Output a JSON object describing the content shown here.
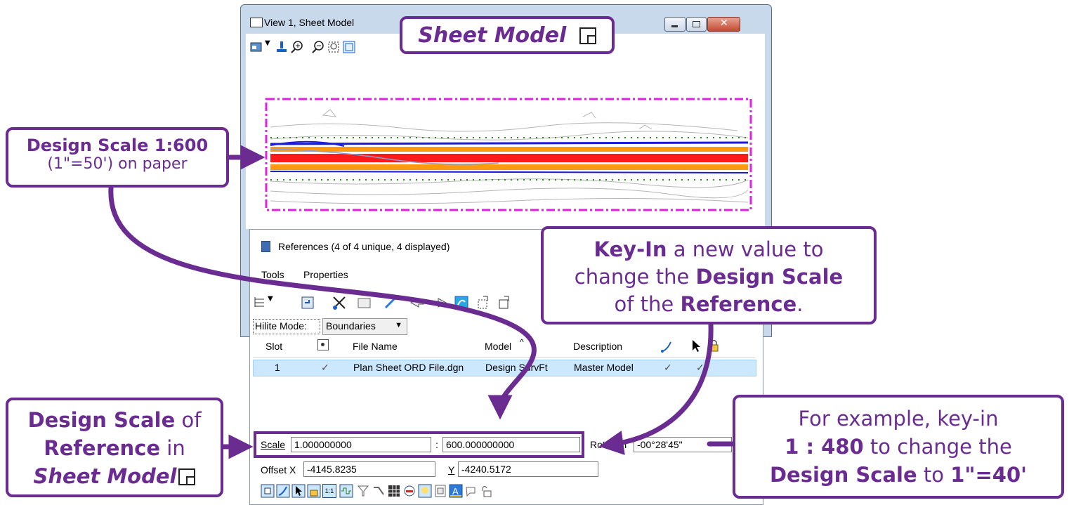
{
  "window": {
    "title": "View 1, Sheet Model"
  },
  "references": {
    "title": "References (4 of 4 unique, 4 displayed)",
    "menu": [
      "Tools",
      "Properties"
    ],
    "hilite_label": "Hilite Mode:",
    "hilite_value": "Boundaries",
    "columns": [
      "Slot",
      "File Name",
      "Model",
      "Description"
    ],
    "rows": [
      {
        "slot": "1",
        "display_check": "✓",
        "file_name": "Plan Sheet ORD File.dgn",
        "model": "Design SurvFt",
        "description": "Master Model",
        "check1": "✓",
        "check2": "✓"
      }
    ],
    "scale_label": "Scale",
    "scale_master": "1.000000000",
    "scale_sep": ":",
    "scale_ref": "600.000000000",
    "rotation_label": "Rotation",
    "rotation_value": "-00°28'45\"",
    "offset_x_label": "Offset X",
    "offset_x": "-4145.8235",
    "offset_y_label": "Y",
    "offset_y": "-4240.5172",
    "scale_btn": "1:1"
  },
  "callouts": {
    "sheet_model": "Sheet Model",
    "design_scale_title": "Design Scale 1:600",
    "design_scale_sub": "(1\"=50') on paper",
    "keyin_1": "Key-In",
    "keyin_2": " a new value to",
    "keyin_3": "change the ",
    "keyin_4": "Design Scale",
    "keyin_5": "of the ",
    "keyin_6": "Reference",
    "keyin_7": ".",
    "ref_1": "Design Scale",
    "ref_2": " of",
    "ref_3": "Reference",
    "ref_4": " in",
    "ref_5": "Sheet Model",
    "example_1": "For example, key-in",
    "example_2": "1 : 480",
    "example_3": " to change the",
    "example_4": "Design Scale",
    "example_5": " to ",
    "example_6": "1\"=40'"
  },
  "colors": {
    "accent": "#6b2c91",
    "boundary": "#e020e0",
    "red_line": "#ff1a1a",
    "orange_line": "#ff9a10",
    "blue_line": "#1a1ad8"
  }
}
